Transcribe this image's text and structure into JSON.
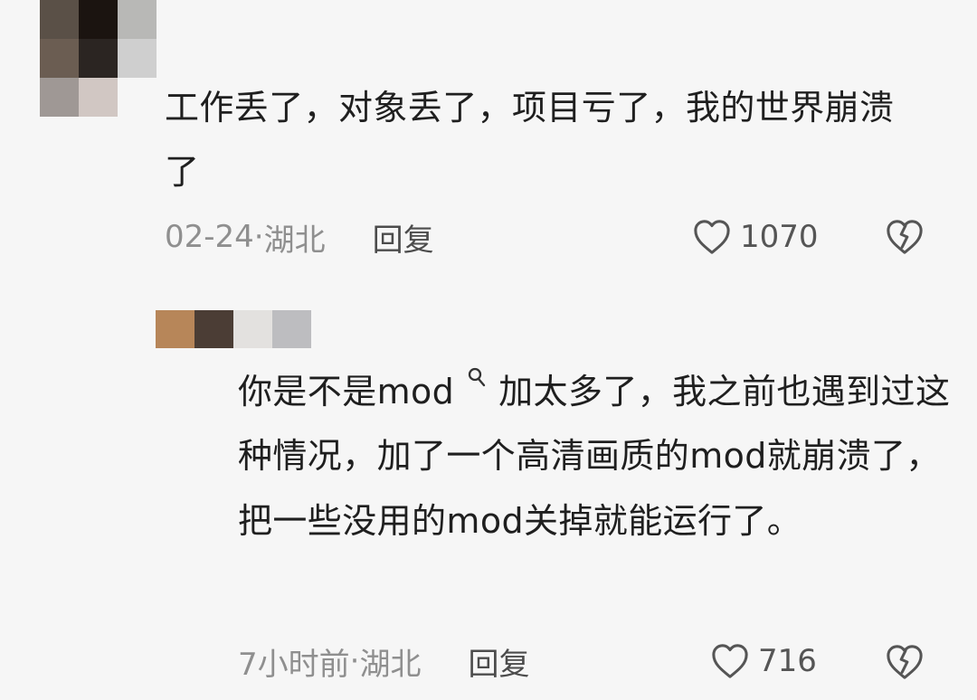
{
  "comments": [
    {
      "text": "工作丢了，对象丢了，项目亏了，我的世界崩溃了",
      "time": "02-24",
      "separator": " · ",
      "location": "湖北",
      "reply_label": "回复",
      "likes": "1070",
      "avatar_colors": [
        "#5a5047",
        "#1b1410",
        "#b8b8b6",
        "#6b5d52",
        "#2b2522",
        "#cfcfcf",
        "#9f9895",
        "#d1c7c3",
        "#f6f6f6"
      ]
    },
    {
      "text_before_icon": "你是不是mod",
      "text_after_icon": "加太多了，我之前也遇到过这种情况，加了一个高清画质的mod就崩溃了，把一些没用的mod关掉就能运行了。",
      "time": "7小时前",
      "separator": " · ",
      "location": "湖北",
      "reply_label": "回复",
      "likes": "716",
      "avatar_colors": [
        "#b78659",
        "#4b3d35",
        "#e3e1df",
        "#bdbdc0"
      ]
    }
  ],
  "icons": {
    "like": "heart-outline-icon",
    "dislike": "broken-heart-icon",
    "search_hint": "search-icon"
  },
  "colors": {
    "background": "#f6f6f6",
    "primary_text": "#1f1f1f",
    "meta_text": "#8f8f8f",
    "icon": "#555555"
  }
}
